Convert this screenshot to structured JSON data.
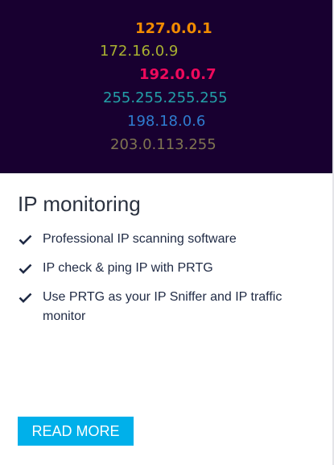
{
  "hero": {
    "ips": [
      {
        "text": "127.0.0.1",
        "color": "#f28c00"
      },
      {
        "text": "172.16.0.9",
        "color": "#a8b030"
      },
      {
        "text": "192.0.0.7",
        "color": "#ee0a5c"
      },
      {
        "text": "255.255.255.255",
        "color": "#23a0a8"
      },
      {
        "text": "198.18.0.6",
        "color": "#2f7cd0"
      },
      {
        "text": "203.0.113.255",
        "color": "#7f7550"
      }
    ]
  },
  "title": "IP monitoring",
  "features": [
    "Professional IP scanning software",
    "IP check & ping IP with PRTG",
    "Use PRTG as your IP Sniffer and IP traffic monitor"
  ],
  "button": {
    "label": "READ MORE",
    "color": "#00b0ea"
  }
}
